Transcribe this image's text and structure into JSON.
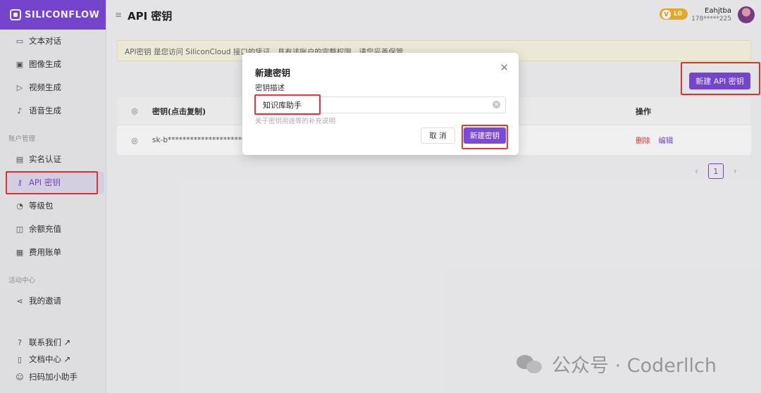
{
  "brand": {
    "name": "SILICONFLOW"
  },
  "sidebar": {
    "items_top": [
      {
        "icon": "chat-icon",
        "label": "文本对话"
      },
      {
        "icon": "image-icon",
        "label": "图像生成"
      },
      {
        "icon": "video-icon",
        "label": "视频生成"
      },
      {
        "icon": "mic-icon",
        "label": "语音生成"
      }
    ],
    "group_account": "账户管理",
    "items_account": [
      {
        "icon": "id-card-icon",
        "label": "实名认证"
      },
      {
        "icon": "key-icon",
        "label": "API 密钥"
      },
      {
        "icon": "gauge-icon",
        "label": "等级包"
      },
      {
        "icon": "wallet-icon",
        "label": "余额充值"
      },
      {
        "icon": "bill-icon",
        "label": "费用账单"
      }
    ],
    "group_activity": "活动中心",
    "items_activity": [
      {
        "icon": "share-icon",
        "label": "我的邀请"
      }
    ],
    "items_bottom": [
      {
        "icon": "help-icon",
        "label": "联系我们 ↗"
      },
      {
        "icon": "doc-icon",
        "label": "文档中心 ↗"
      },
      {
        "icon": "user-icon",
        "label": "扫码加小助手"
      }
    ]
  },
  "header": {
    "title": "API 密钥",
    "level": "L0",
    "user_name": "Eahjtba",
    "user_phone": "178*****225"
  },
  "notice": "API密钥 是您访问 SiliconCloud 接口的凭证，具有该账户的完整权限，请您妥善保管",
  "new_key_button": "新建 API 密钥",
  "table": {
    "headers": {
      "key": "密钥(点击复制)",
      "ops": "操作"
    },
    "rows": [
      {
        "key": "sk-b**************************",
        "delete": "删除",
        "edit": "编辑"
      }
    ]
  },
  "pager": {
    "current": "1"
  },
  "modal": {
    "title": "新建密钥",
    "field_label": "密钥描述",
    "input_value": "知识库助手",
    "help_text": "关于密钥用途等的补充说明",
    "cancel": "取 消",
    "submit": "新建密钥"
  },
  "watermark": "公众号 · Coderllch"
}
